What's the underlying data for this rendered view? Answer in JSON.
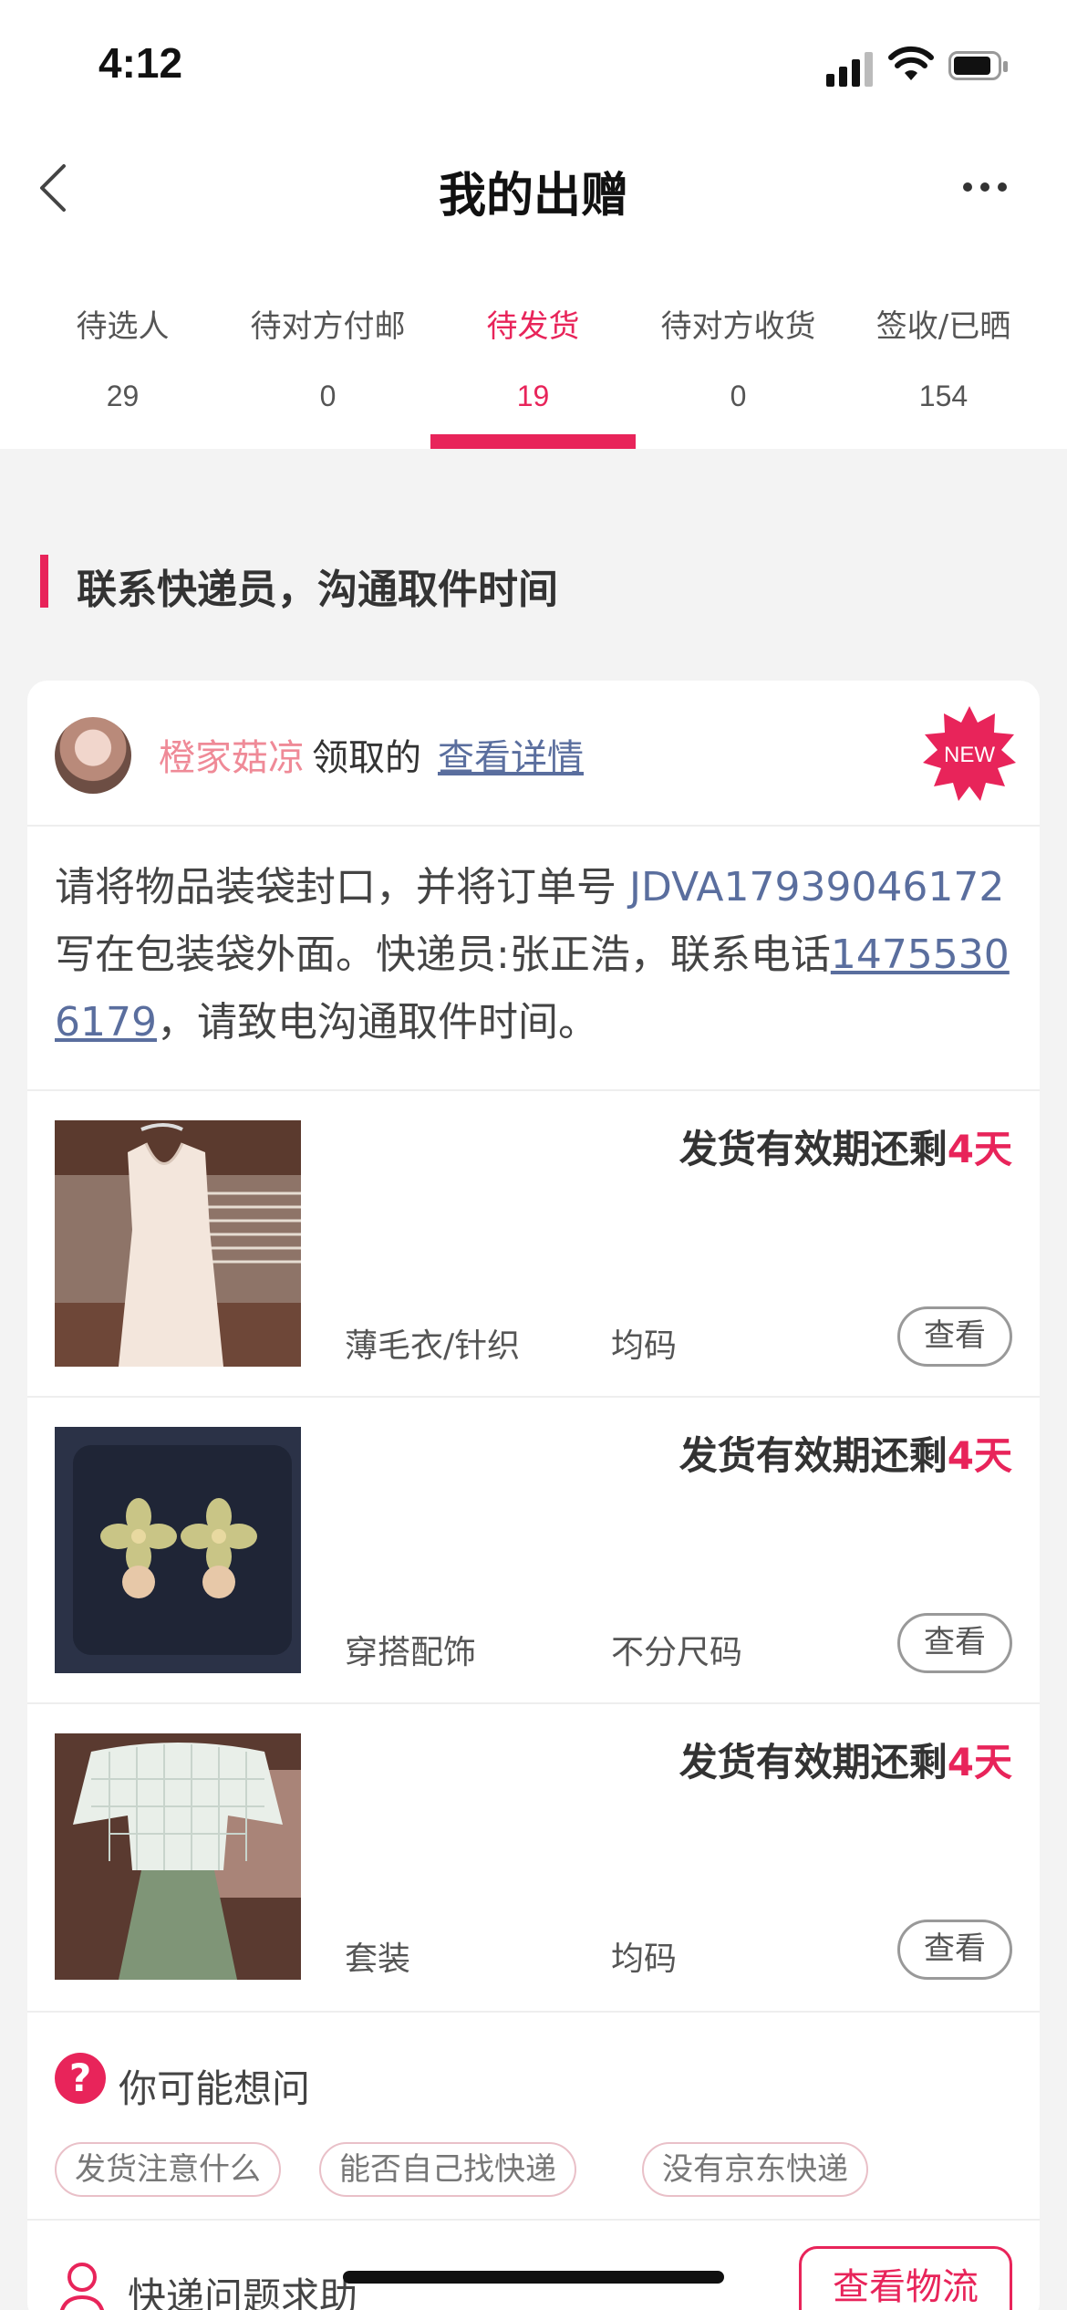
{
  "status_bar": {
    "time": "4:12"
  },
  "header": {
    "title": "我的出赠"
  },
  "tabs": [
    {
      "label": "待选人",
      "count": "29"
    },
    {
      "label": "待对方付邮",
      "count": "0"
    },
    {
      "label": "待发货",
      "count": "19",
      "active": true
    },
    {
      "label": "待对方收货",
      "count": "0"
    },
    {
      "label": "签收/已晒",
      "count": "154"
    }
  ],
  "section": {
    "title": "联系快递员，沟通取件时间"
  },
  "card": {
    "user_name": "橙家菇凉",
    "claimed_text": "领取的",
    "detail_link": "查看详情",
    "badge": "NEW",
    "instruction": {
      "part1": "请将物品装袋封口，并将订单号 ",
      "order_no": "JDVA17939046172",
      "part2": " 写在包装袋外面。快递员:张正浩，联系电话",
      "phone": "14755306179",
      "part3": "，请致电沟通取件时间。"
    },
    "items": [
      {
        "deadline_prefix": "发货有效期还剩",
        "days": "4天",
        "category": "薄毛衣/针织",
        "size": "均码",
        "view_label": "查看"
      },
      {
        "deadline_prefix": "发货有效期还剩",
        "days": "4天",
        "category": "穿搭配饰",
        "size": "不分尺码",
        "view_label": "查看"
      },
      {
        "deadline_prefix": "发货有效期还剩",
        "days": "4天",
        "category": "套装",
        "size": "均码",
        "view_label": "查看"
      }
    ],
    "faq": {
      "icon": "?",
      "title": "你可能想问",
      "chips": [
        "发货注意什么",
        "能否自己找快递",
        "没有京东快递"
      ]
    },
    "help": {
      "label": "快递问题求助",
      "button": "查看物流"
    }
  },
  "colors": {
    "accent": "#e8245a",
    "link": "#5a6e9e",
    "username": "#ef8a97"
  }
}
